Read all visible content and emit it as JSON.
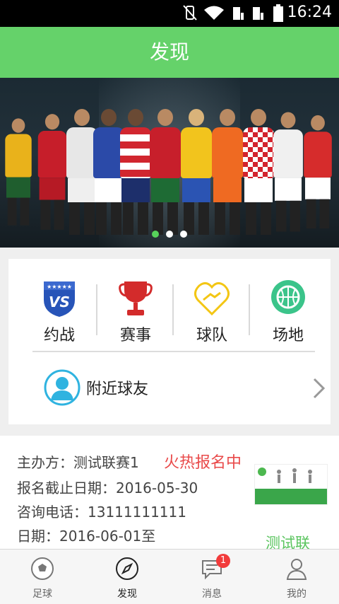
{
  "status_bar": {
    "time": "16:24"
  },
  "header": {
    "title": "发现"
  },
  "banner": {
    "active_slide": 1,
    "slide_count": 3
  },
  "menu": {
    "items": [
      {
        "label": "约战",
        "icon": "vs-shield-icon"
      },
      {
        "label": "赛事",
        "icon": "trophy-icon"
      },
      {
        "label": "球队",
        "icon": "handshake-icon"
      },
      {
        "label": "场地",
        "icon": "basketball-icon"
      }
    ],
    "nearby": {
      "label": "附近球友",
      "icon": "user-avatar-icon"
    }
  },
  "event": {
    "organizer": "主办方：测试联赛1",
    "status": "火热报名中",
    "deadline": "报名截止日期：2016-05-30",
    "phone": "咨询电话：13111111111",
    "date": "日期：2016-06-01至",
    "sub_title": "测试联"
  },
  "tabbar": {
    "tabs": [
      {
        "label": "足球",
        "icon": "soccer-ball-icon"
      },
      {
        "label": "发现",
        "icon": "compass-icon"
      },
      {
        "label": "消息",
        "icon": "message-icon",
        "badge": "1"
      },
      {
        "label": "我的",
        "icon": "person-icon"
      }
    ],
    "active": "发现"
  },
  "colors": {
    "accent": "#65d26a",
    "hot": "#e94a4a",
    "badge": "#f23b3b"
  }
}
